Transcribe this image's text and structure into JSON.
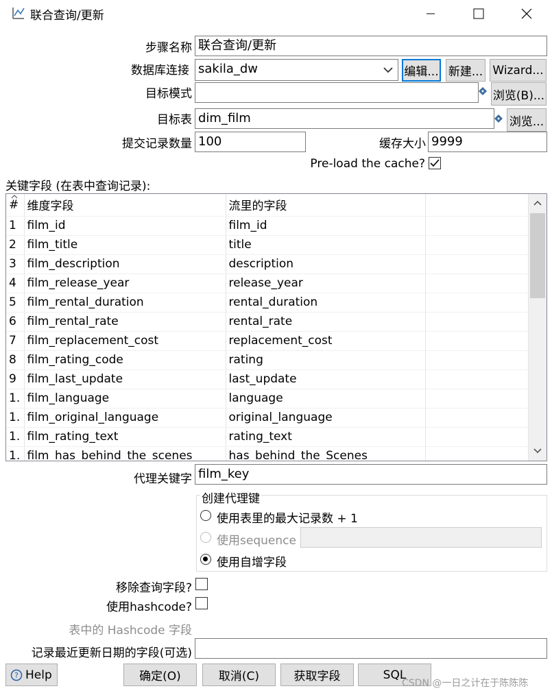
{
  "window": {
    "title": "联合查询/更新",
    "minimize_glyph": "—",
    "maximize_glyph": "☐",
    "close_glyph": "✕"
  },
  "form": {
    "step_name_label": "步骤名称",
    "step_name_value": "联合查询/更新",
    "db_conn_label": "数据库连接",
    "db_conn_value": "sakila_dw",
    "edit_button": "编辑...",
    "new_button": "新建...",
    "wizard_button": "Wizard...",
    "target_schema_label": "目标模式",
    "target_schema_value": "",
    "browse_b_button": "浏览(B)...",
    "target_table_label": "目标表",
    "target_table_value": "dim_film",
    "browse_button": "浏览...",
    "commit_size_label": "提交记录数量",
    "commit_size_value": "100",
    "cache_size_label": "缓存大小",
    "cache_size_value": "9999",
    "preload_label": "Pre-load the cache?",
    "preload_checked": true
  },
  "keys_section": {
    "label": "关键字段 (在表中查询记录):",
    "columns": [
      "#",
      "维度字段",
      "流里的字段"
    ],
    "rows": [
      {
        "num": "1",
        "dim": "film_id",
        "stream": "film_id"
      },
      {
        "num": "2",
        "dim": "film_title",
        "stream": "title"
      },
      {
        "num": "3",
        "dim": "film_description",
        "stream": "description"
      },
      {
        "num": "4",
        "dim": "film_release_year",
        "stream": "release_year"
      },
      {
        "num": "5",
        "dim": "film_rental_duration",
        "stream": "rental_duration"
      },
      {
        "num": "6",
        "dim": "film_rental_rate",
        "stream": "rental_rate"
      },
      {
        "num": "7",
        "dim": "film_replacement_cost",
        "stream": "replacement_cost"
      },
      {
        "num": "8",
        "dim": "film_rating_code",
        "stream": "rating"
      },
      {
        "num": "9",
        "dim": "film_last_update",
        "stream": "last_update"
      },
      {
        "num": "1.",
        "dim": "film_language",
        "stream": "language"
      },
      {
        "num": "1.",
        "dim": "film_original_language",
        "stream": "original_language"
      },
      {
        "num": "1.",
        "dim": "film_rating_text",
        "stream": "rating_text"
      },
      {
        "num": "1.",
        "dim": "film_has_behind_the_scenes",
        "stream": "has_behind_the_Scenes"
      }
    ]
  },
  "surrogate": {
    "label": "代理关键字",
    "value": "film_key",
    "group_title": "创建代理键",
    "opt_max": "使用表里的最大记录数 + 1",
    "opt_sequence": "使用sequence",
    "sequence_value": "",
    "opt_auto": "使用自增字段",
    "selected": "auto"
  },
  "options": {
    "remove_lookup_label": "移除查询字段?",
    "use_hashcode_label": "使用hashcode?",
    "hashcode_field_label": "表中的 Hashcode 字段",
    "last_update_label": "记录最近更新日期的字段(可选)",
    "last_update_value": ""
  },
  "footer": {
    "help": "Help",
    "ok": "确定(O)",
    "cancel": "取消(C)",
    "get_fields": "获取字段",
    "sql": "SQL",
    "watermark": "CSDN @一日之计在于陈陈陈"
  }
}
